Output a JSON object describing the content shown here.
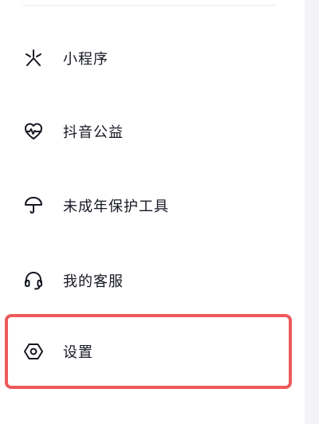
{
  "menu": {
    "items": [
      {
        "label": "小程序",
        "icon": "mini-program-icon"
      },
      {
        "label": "抖音公益",
        "icon": "heart-pulse-icon"
      },
      {
        "label": "未成年保护工具",
        "icon": "umbrella-icon"
      },
      {
        "label": "我的客服",
        "icon": "headset-icon"
      },
      {
        "label": "设置",
        "icon": "settings-hexagon-icon"
      }
    ]
  },
  "colors": {
    "text": "#161823",
    "highlight": "#ee5a5a",
    "background": "#ffffff"
  }
}
